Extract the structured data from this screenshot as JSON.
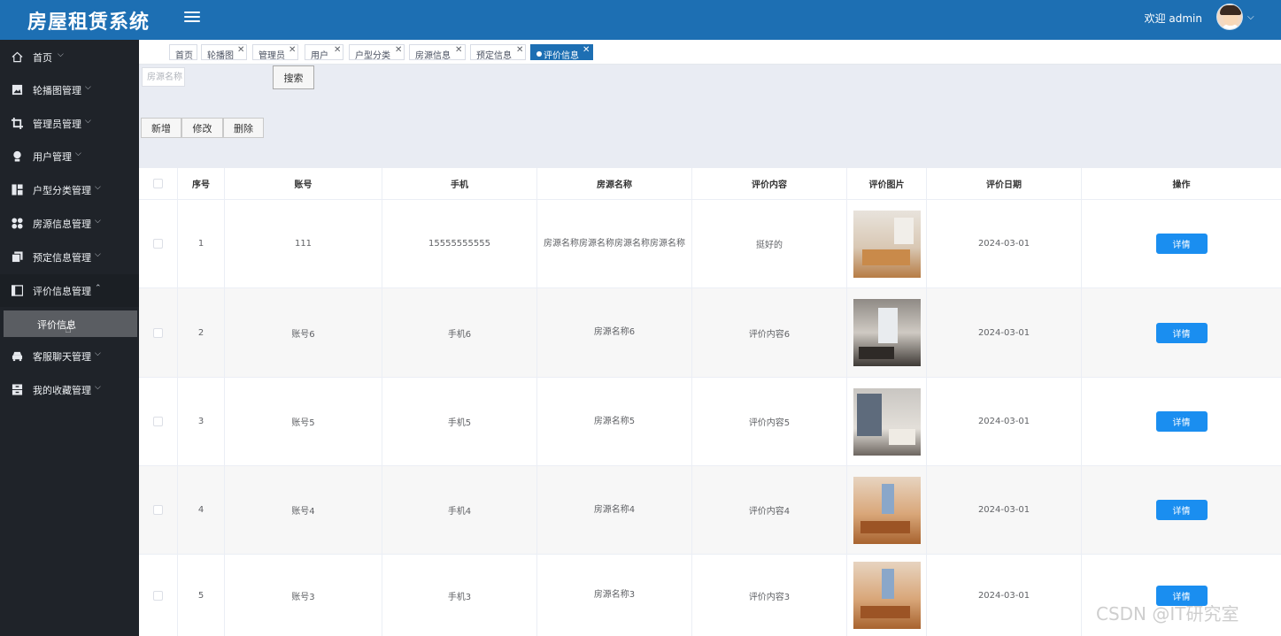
{
  "app": {
    "title": "房屋租赁系统",
    "welcome": "欢迎 admin"
  },
  "sidebar": {
    "items": [
      {
        "label": "首页",
        "icon": "home-icon"
      },
      {
        "label": "轮播图管理",
        "icon": "picture-icon"
      },
      {
        "label": "管理员管理",
        "icon": "crop-icon"
      },
      {
        "label": "用户管理",
        "icon": "user-icon"
      },
      {
        "label": "户型分类管理",
        "icon": "grid-icon"
      },
      {
        "label": "房源信息管理",
        "icon": "apps-icon"
      },
      {
        "label": "预定信息管理",
        "icon": "copy-icon"
      },
      {
        "label": "评价信息管理",
        "icon": "panel-icon"
      },
      {
        "label": "客服聊天管理",
        "icon": "car-icon"
      },
      {
        "label": "我的收藏管理",
        "icon": "archive-icon"
      }
    ],
    "active_sub": "评价信息"
  },
  "tabs": [
    {
      "label": "首页"
    },
    {
      "label": "轮播图"
    },
    {
      "label": "管理员"
    },
    {
      "label": "用户"
    },
    {
      "label": "户型分类"
    },
    {
      "label": "房源信息"
    },
    {
      "label": "预定信息"
    },
    {
      "label": "评价信息",
      "active": true
    }
  ],
  "search": {
    "placeholder": "房源名称",
    "button": "搜索"
  },
  "actions": {
    "add": "新增",
    "edit": "修改",
    "delete": "删除"
  },
  "table": {
    "columns": [
      "序号",
      "账号",
      "手机",
      "房源名称",
      "评价内容",
      "评价图片",
      "评价日期",
      "操作"
    ],
    "detail_label": "详情",
    "rows": [
      {
        "no": "1",
        "account": "111",
        "phone": "15555555555",
        "house": "房源名称房源名称房源名称房源名称",
        "content": "挺好的",
        "date": "2024-03-01"
      },
      {
        "no": "2",
        "account": "账号6",
        "phone": "手机6",
        "house": "房源名称6",
        "content": "评价内容6",
        "date": "2024-03-01"
      },
      {
        "no": "3",
        "account": "账号5",
        "phone": "手机5",
        "house": "房源名称5",
        "content": "评价内容5",
        "date": "2024-03-01"
      },
      {
        "no": "4",
        "account": "账号4",
        "phone": "手机4",
        "house": "房源名称4",
        "content": "评价内容4",
        "date": "2024-03-01"
      },
      {
        "no": "5",
        "account": "账号3",
        "phone": "手机3",
        "house": "房源名称3",
        "content": "评价内容3",
        "date": "2024-03-01"
      }
    ]
  },
  "watermark": "CSDN @IT研究室"
}
